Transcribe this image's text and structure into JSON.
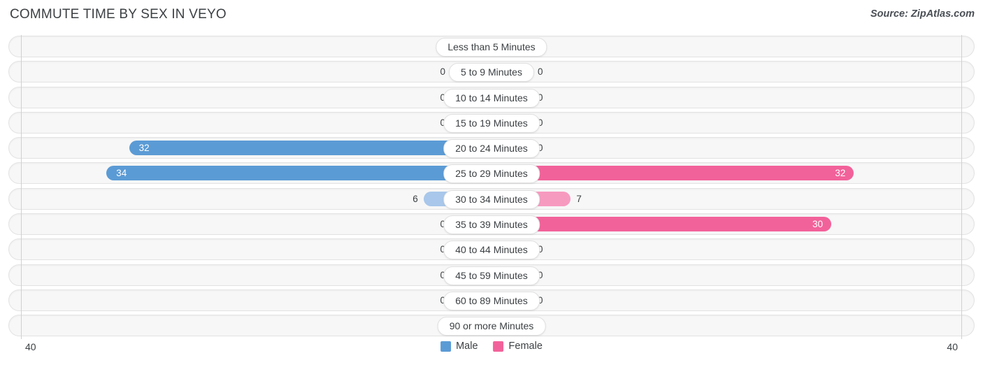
{
  "header": {
    "title": "COMMUTE TIME BY SEX IN VEYO",
    "source": "Source: ZipAtlas.com"
  },
  "axis": {
    "left_tick": "40",
    "right_tick": "40"
  },
  "legend": {
    "items": [
      {
        "label": "Male",
        "color": "#5b9bd5"
      },
      {
        "label": "Female",
        "color": "#f2629a"
      }
    ]
  },
  "colors": {
    "male_solid": "#5b9bd5",
    "male_light": "#aec9ea",
    "female_solid": "#f2629a",
    "female_light": "#f9a8c4",
    "track": "#f7f7f7",
    "track_border": "#e3e3e3",
    "text": "#3c4043"
  },
  "chart_data": {
    "type": "bar",
    "title": "COMMUTE TIME BY SEX IN VEYO",
    "subtitle": "Source: ZipAtlas.com",
    "orientation": "horizontal-diverging",
    "xlabel": "",
    "ylabel": "",
    "xlim": [
      40,
      40
    ],
    "axis_max": 40,
    "grid": false,
    "legend_position": "bottom-center",
    "categories": [
      "Less than 5 Minutes",
      "5 to 9 Minutes",
      "10 to 14 Minutes",
      "15 to 19 Minutes",
      "20 to 24 Minutes",
      "25 to 29 Minutes",
      "30 to 34 Minutes",
      "35 to 39 Minutes",
      "40 to 44 Minutes",
      "45 to 59 Minutes",
      "60 to 89 Minutes",
      "90 or more Minutes"
    ],
    "series": [
      {
        "name": "Male",
        "color": "#5b9bd5",
        "values": [
          0,
          0,
          0,
          0,
          32,
          34,
          6,
          0,
          0,
          0,
          0,
          0
        ]
      },
      {
        "name": "Female",
        "color": "#f2629a",
        "values": [
          0,
          0,
          0,
          0,
          0,
          32,
          7,
          30,
          0,
          0,
          0,
          0
        ]
      }
    ]
  },
  "rows": [
    {
      "category": "Less than 5 Minutes",
      "male": "0",
      "female": "0",
      "male_value": 0,
      "female_value": 0
    },
    {
      "category": "5 to 9 Minutes",
      "male": "0",
      "female": "0",
      "male_value": 0,
      "female_value": 0
    },
    {
      "category": "10 to 14 Minutes",
      "male": "0",
      "female": "0",
      "male_value": 0,
      "female_value": 0
    },
    {
      "category": "15 to 19 Minutes",
      "male": "0",
      "female": "0",
      "male_value": 0,
      "female_value": 0
    },
    {
      "category": "20 to 24 Minutes",
      "male": "32",
      "female": "0",
      "male_value": 32,
      "female_value": 0
    },
    {
      "category": "25 to 29 Minutes",
      "male": "34",
      "female": "32",
      "male_value": 34,
      "female_value": 32
    },
    {
      "category": "30 to 34 Minutes",
      "male": "6",
      "female": "7",
      "male_value": 6,
      "female_value": 7
    },
    {
      "category": "35 to 39 Minutes",
      "male": "0",
      "female": "30",
      "male_value": 0,
      "female_value": 30
    },
    {
      "category": "40 to 44 Minutes",
      "male": "0",
      "female": "0",
      "male_value": 0,
      "female_value": 0
    },
    {
      "category": "45 to 59 Minutes",
      "male": "0",
      "female": "0",
      "male_value": 0,
      "female_value": 0
    },
    {
      "category": "60 to 89 Minutes",
      "male": "0",
      "female": "0",
      "male_value": 0,
      "female_value": 0
    },
    {
      "category": "90 or more Minutes",
      "male": "0",
      "female": "0",
      "male_value": 0,
      "female_value": 0
    }
  ]
}
